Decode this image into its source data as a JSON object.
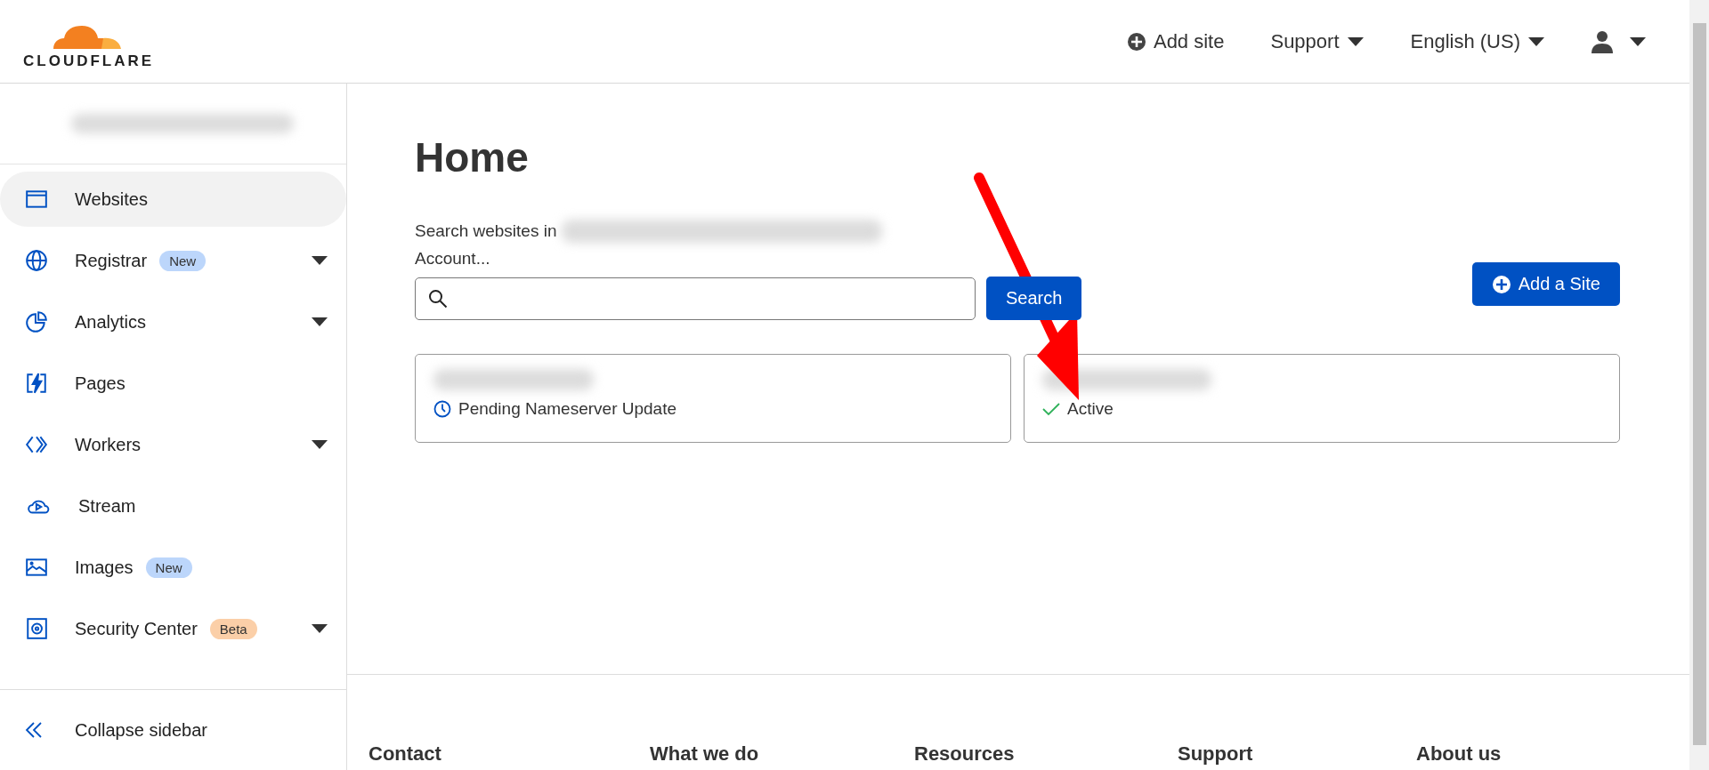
{
  "header": {
    "logo": "CLOUDFLARE",
    "add_site": "Add site",
    "menus": [
      "Support",
      "English (US)"
    ]
  },
  "sidebar": {
    "items": [
      {
        "label": "Websites",
        "kind": "browser",
        "selected": true,
        "expandable": false
      },
      {
        "label": "Registrar",
        "kind": "globe",
        "selected": false,
        "expandable": true,
        "badge": {
          "text": "New",
          "kind": "new"
        }
      },
      {
        "label": "Analytics",
        "kind": "pie",
        "selected": false,
        "expandable": true
      },
      {
        "label": "Pages",
        "kind": "bolt",
        "selected": false,
        "expandable": false
      },
      {
        "label": "Workers",
        "kind": "chevrons",
        "selected": false,
        "expandable": true
      },
      {
        "label": "Stream",
        "kind": "cloud",
        "selected": false,
        "expandable": false
      },
      {
        "label": "Images",
        "kind": "image",
        "selected": false,
        "expandable": false,
        "badge": {
          "text": "New",
          "kind": "new"
        }
      },
      {
        "label": "Security Center",
        "kind": "safe",
        "selected": false,
        "expandable": true,
        "badge": {
          "text": "Beta",
          "kind": "beta"
        }
      }
    ],
    "collapse": "Collapse sidebar"
  },
  "main": {
    "title": "Home",
    "search_label": "Search websites in",
    "search_label_end": "Account...",
    "search_button": "Search",
    "add_button": "Add a Site",
    "sites": [
      {
        "status": "Pending Nameserver Update",
        "kind": "pending"
      },
      {
        "status": "Active",
        "kind": "active"
      }
    ]
  },
  "footer": {
    "headings": [
      "Contact",
      "What we do",
      "Resources",
      "Support",
      "About us"
    ]
  }
}
